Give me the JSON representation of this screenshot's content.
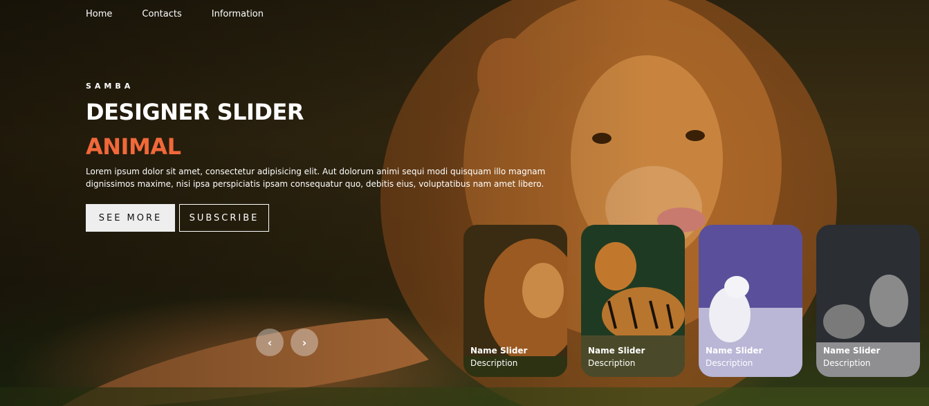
{
  "nav": {
    "items": [
      "Home",
      "Contacts",
      "Information"
    ]
  },
  "hero": {
    "author": "SAMBA",
    "title": "DESIGNER SLIDER",
    "topic": "ANIMAL",
    "description": "Lorem ipsum dolor sit amet, consectetur adipisicing elit. Aut dolorum animi sequi modi quisquam illo magnam dignissimos maxime, nisi ipsa perspiciatis ipsam consequatur quo, debitis eius, voluptatibus nam amet libero.",
    "see_more_label": "SEE MORE",
    "subscribe_label": "SUBSCRIBE"
  },
  "thumbnails": [
    {
      "name": "Name Slider",
      "description": "Description",
      "subject": "lion"
    },
    {
      "name": "Name Slider",
      "description": "Description",
      "subject": "tiger"
    },
    {
      "name": "Name Slider",
      "description": "Description",
      "subject": "arctic-fox"
    },
    {
      "name": "Name Slider",
      "description": "Description",
      "subject": "wolves"
    }
  ],
  "arrows": {
    "prev_icon": "chevron-left-icon",
    "next_icon": "chevron-right-icon",
    "prev_glyph": "‹",
    "next_glyph": "›"
  },
  "colors": {
    "accent": "#f1683a",
    "see_more_bg": "#eeeeee"
  }
}
